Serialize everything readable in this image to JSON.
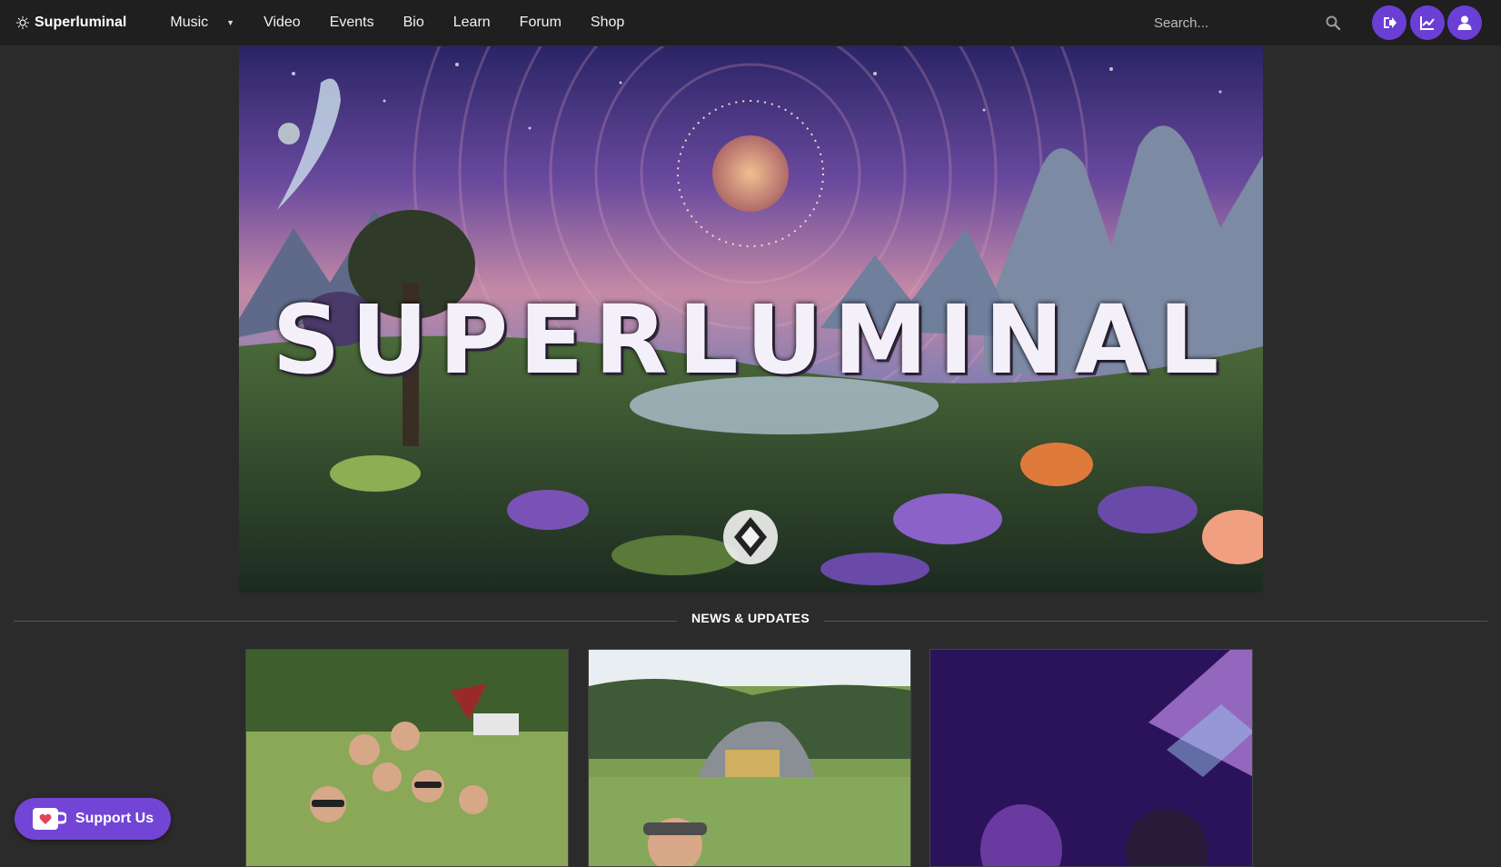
{
  "navbar": {
    "brand": "Superluminal",
    "items": [
      {
        "label": "Music",
        "has_dropdown": true
      },
      {
        "label": "Video"
      },
      {
        "label": "Events"
      },
      {
        "label": "Bio"
      },
      {
        "label": "Learn"
      },
      {
        "label": "Forum"
      },
      {
        "label": "Shop"
      }
    ],
    "search_placeholder": "Search...",
    "actions": [
      "logout-icon",
      "stats-icon",
      "user-icon"
    ]
  },
  "hero": {
    "logo_text": "SUPERLUMINAL"
  },
  "section": {
    "title": "NEWS & UPDATES"
  },
  "cards": [
    {
      "image": "group-selfie-festival-meadow"
    },
    {
      "image": "selfie-forest-stage"
    },
    {
      "image": "purple-stage-lights-selfie"
    }
  ],
  "support": {
    "label": "Support Us"
  },
  "colors": {
    "accent": "#6b3fd6",
    "navbar_bg": "#1f1f1f",
    "page_bg": "#2b2b2b"
  }
}
